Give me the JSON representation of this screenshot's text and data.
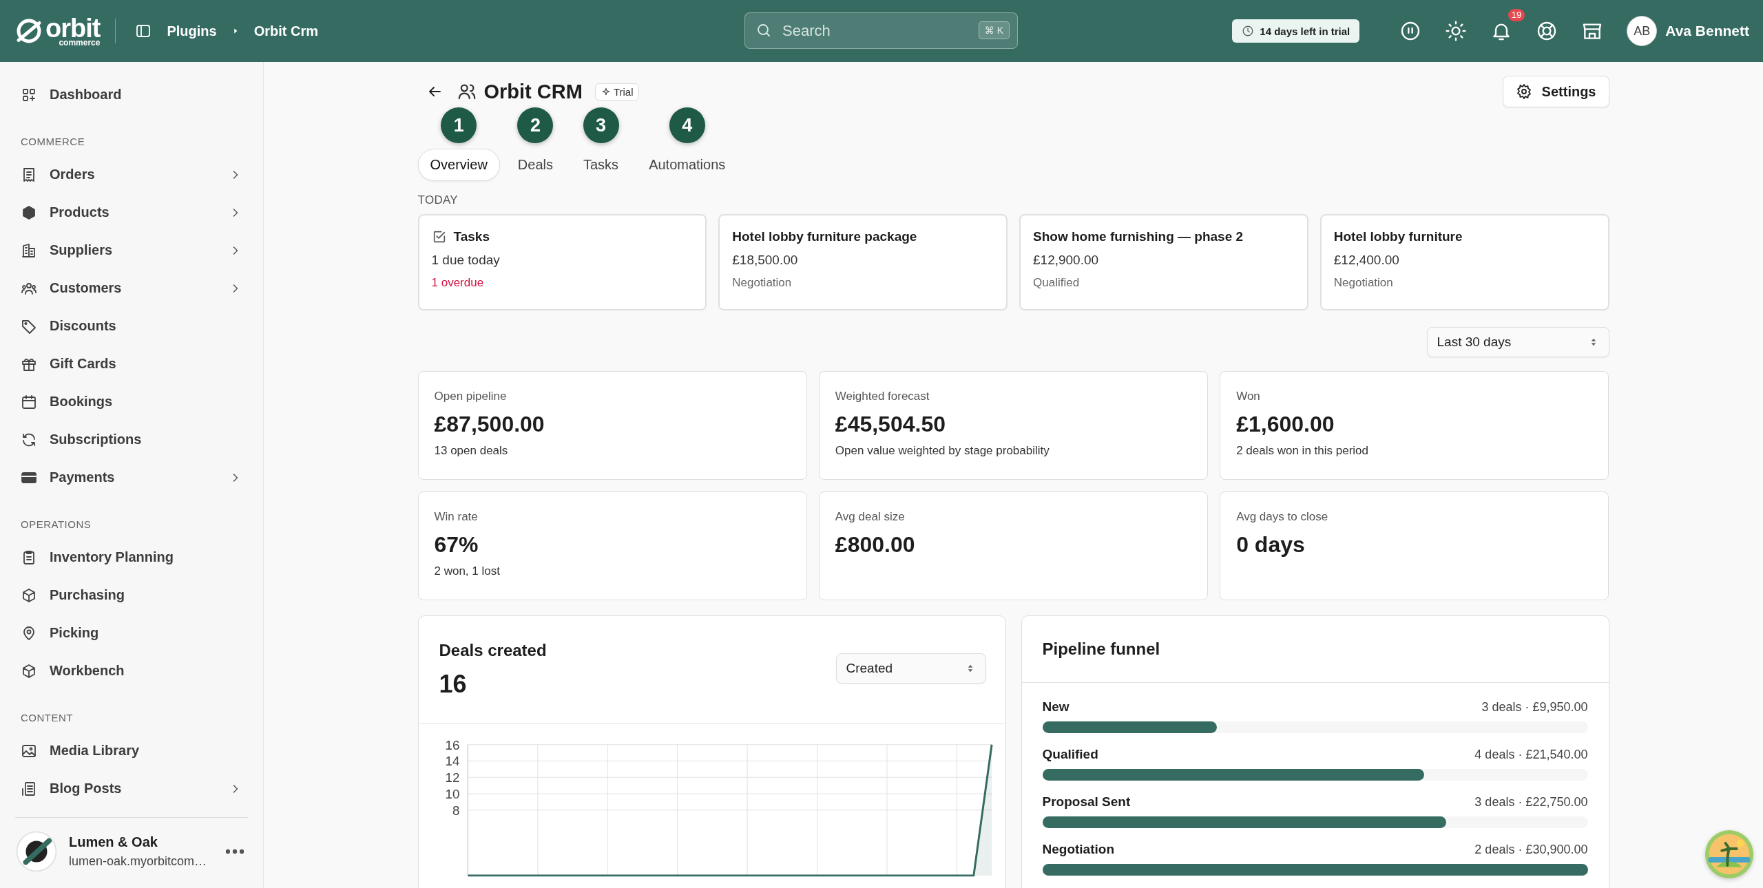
{
  "topbar": {
    "logo": {
      "word": "orbit",
      "sub": "commerce"
    },
    "breadcrumb": [
      "Plugins",
      "Orbit Crm"
    ],
    "search": {
      "placeholder": "Search",
      "shortcut": "⌘ K"
    },
    "trial": "14 days left in trial",
    "notifications": "19",
    "user": {
      "initials": "AB",
      "name": "Ava Bennett"
    }
  },
  "sidebar": {
    "sections": [
      {
        "items": [
          {
            "label": "Dashboard",
            "expandable": false
          }
        ]
      },
      {
        "title": "COMMERCE",
        "items": [
          {
            "label": "Orders",
            "expandable": true
          },
          {
            "label": "Products",
            "expandable": true
          },
          {
            "label": "Suppliers",
            "expandable": true
          },
          {
            "label": "Customers",
            "expandable": true
          },
          {
            "label": "Discounts",
            "expandable": false
          },
          {
            "label": "Gift Cards",
            "expandable": false
          },
          {
            "label": "Bookings",
            "expandable": false
          },
          {
            "label": "Subscriptions",
            "expandable": false
          },
          {
            "label": "Payments",
            "expandable": true
          }
        ]
      },
      {
        "title": "OPERATIONS",
        "items": [
          {
            "label": "Inventory Planning",
            "expandable": false
          },
          {
            "label": "Purchasing",
            "expandable": false
          },
          {
            "label": "Picking",
            "expandable": false
          },
          {
            "label": "Workbench",
            "expandable": false
          }
        ]
      },
      {
        "title": "CONTENT",
        "items": [
          {
            "label": "Media Library",
            "expandable": false
          },
          {
            "label": "Blog Posts",
            "expandable": true
          }
        ]
      }
    ],
    "store": {
      "name": "Lumen & Oak",
      "domain": "lumen-oak.myorbitcom…"
    }
  },
  "page": {
    "title": "Orbit CRM",
    "badge": "Trial",
    "settings": "Settings",
    "tabs": [
      {
        "label": "Overview",
        "selected": true,
        "step": "1"
      },
      {
        "label": "Deals",
        "selected": false,
        "step": "2"
      },
      {
        "label": "Tasks",
        "selected": false,
        "step": "3"
      },
      {
        "label": "Automations",
        "selected": false,
        "step": "4"
      }
    ],
    "today_label": "TODAY",
    "today": [
      {
        "kind": "tasks",
        "title": "Tasks",
        "line": "1 due today",
        "note": "1 overdue"
      },
      {
        "kind": "deal",
        "title": "Hotel lobby furniture package",
        "line": "£18,500.00",
        "note": "Negotiation"
      },
      {
        "kind": "deal",
        "title": "Show home furnishing — phase 2",
        "line": "£12,900.00",
        "note": "Qualified"
      },
      {
        "kind": "deal",
        "title": "Hotel lobby furniture",
        "line": "£12,400.00",
        "note": "Negotiation"
      }
    ],
    "period": "Last 30 days",
    "kpis": [
      {
        "label": "Open pipeline",
        "value": "£87,500.00",
        "note": "13 open deals"
      },
      {
        "label": "Weighted forecast",
        "value": "£45,504.50",
        "note": "Open value weighted by stage probability"
      },
      {
        "label": "Won",
        "value": "£1,600.00",
        "note": "2 deals won in this period"
      },
      {
        "label": "Win rate",
        "value": "67%",
        "note": "2 won, 1 lost"
      },
      {
        "label": "Avg deal size",
        "value": "£800.00"
      },
      {
        "label": "Avg days to close",
        "value": "0 days"
      }
    ],
    "deals_created": {
      "title": "Deals created",
      "total": "16",
      "metric": "Created",
      "chart_data": {
        "type": "line",
        "grid": true,
        "ylim": [
          0,
          16
        ],
        "yticks": [
          8,
          10,
          12,
          14,
          16
        ],
        "series": [
          {
            "color": "#356b61",
            "values": [
              0,
              0,
              0,
              0,
              0,
              0,
              0,
              0,
              0,
              0,
              0,
              0,
              0,
              0,
              0,
              0,
              0,
              0,
              0,
              0,
              0,
              0,
              0,
              0,
              0,
              0,
              0,
              0,
              0,
              16
            ]
          }
        ]
      }
    },
    "funnel": {
      "title": "Pipeline funnel",
      "stages": [
        {
          "name": "New",
          "summary": "3 deals · £9,950.00",
          "level": 0.32
        },
        {
          "name": "Qualified",
          "summary": "4 deals · £21,540.00",
          "level": 0.7
        },
        {
          "name": "Proposal Sent",
          "summary": "3 deals · £22,750.00",
          "level": 0.74
        },
        {
          "name": "Negotiation",
          "summary": "2 deals · £30,900.00",
          "level": 1
        }
      ]
    }
  }
}
